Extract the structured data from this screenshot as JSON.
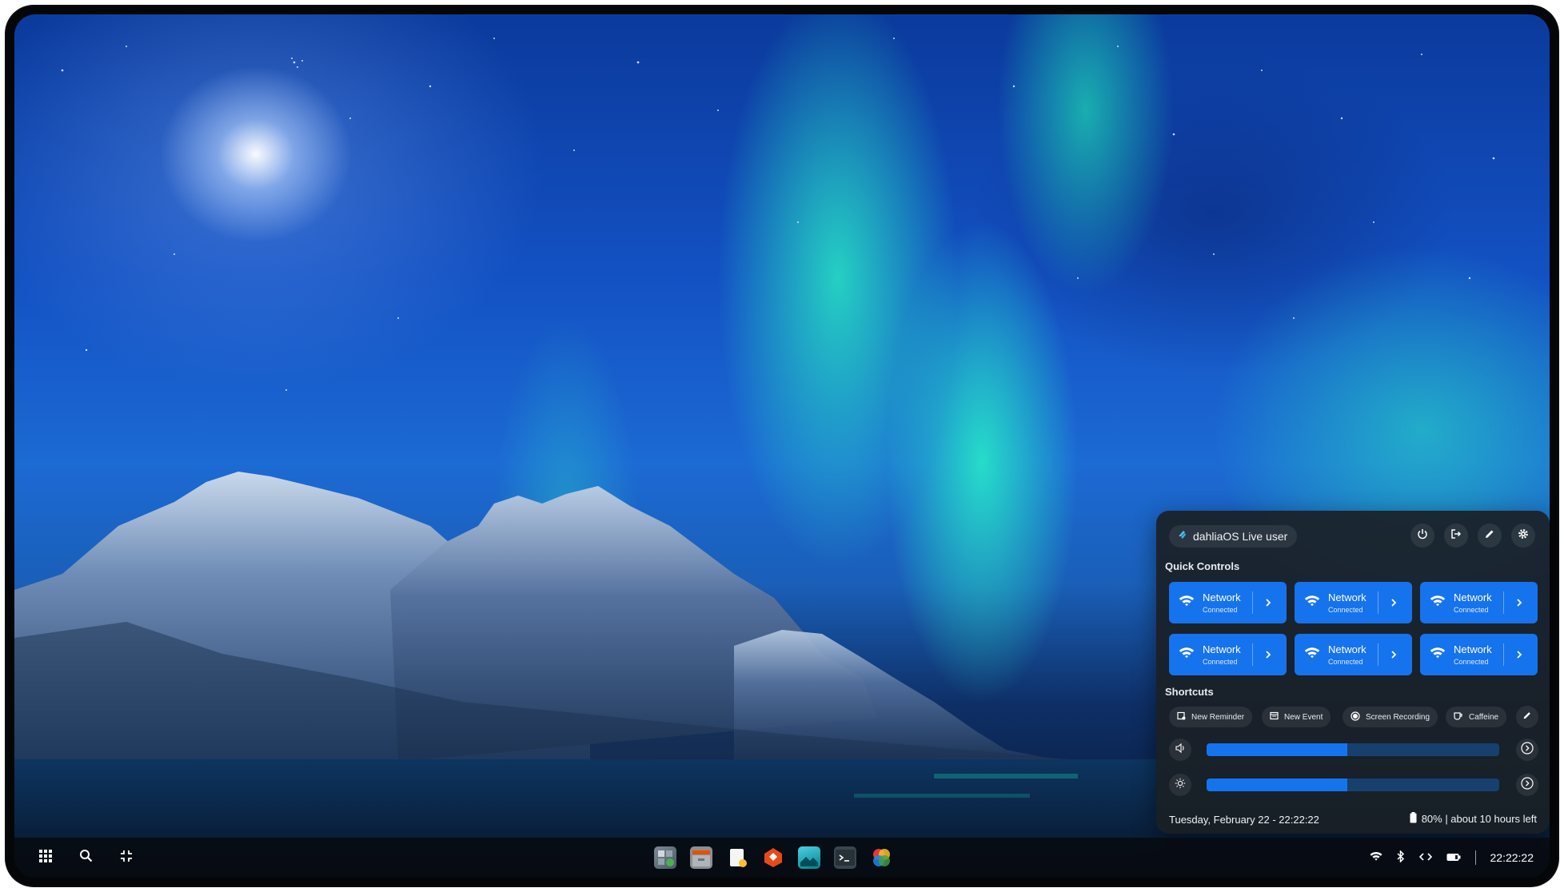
{
  "panel": {
    "user_name": "dahliaOS Live user",
    "header_buttons": [
      "power-icon",
      "logout-icon",
      "edit-icon",
      "settings-icon"
    ],
    "quick_controls_title": "Quick Controls",
    "tiles": [
      {
        "title": "Network",
        "subtitle": "Connected",
        "icon": "wifi-icon"
      },
      {
        "title": "Network",
        "subtitle": "Connected",
        "icon": "wifi-icon"
      },
      {
        "title": "Network",
        "subtitle": "Connected",
        "icon": "wifi-icon"
      },
      {
        "title": "Network",
        "subtitle": "Connected",
        "icon": "wifi-icon"
      },
      {
        "title": "Network",
        "subtitle": "Connected",
        "icon": "wifi-icon"
      },
      {
        "title": "Network",
        "subtitle": "Connected",
        "icon": "wifi-icon"
      }
    ],
    "shortcuts_title": "Shortcuts",
    "shortcuts": [
      {
        "label": "New Reminder",
        "icon": "reminder-icon"
      },
      {
        "label": "New Event",
        "icon": "calendar-icon"
      },
      {
        "label": "Screen Recording",
        "icon": "record-icon"
      },
      {
        "label": "Caffeine",
        "icon": "coffee-icon"
      }
    ],
    "volume_level": 0.48,
    "brightness_level": 0.48,
    "datetime": "Tuesday, February 22 - 22:22:22",
    "battery": "80% | about 10 hours left"
  },
  "taskbar": {
    "left_buttons": [
      "apps-grid-icon",
      "search-icon",
      "overview-icon"
    ],
    "apps": [
      "calculator-app",
      "files-app",
      "notes-app",
      "flutter-app",
      "image-viewer-app",
      "terminal-app",
      "graphics-app"
    ],
    "tray_icons": [
      "wifi-icon",
      "bluetooth-icon",
      "developer-icon",
      "battery-icon"
    ],
    "clock": "22:22:22"
  },
  "colors": {
    "accent": "#1673ee",
    "panel_bg": "#1a2025",
    "taskbar_bg": "#080c12"
  }
}
